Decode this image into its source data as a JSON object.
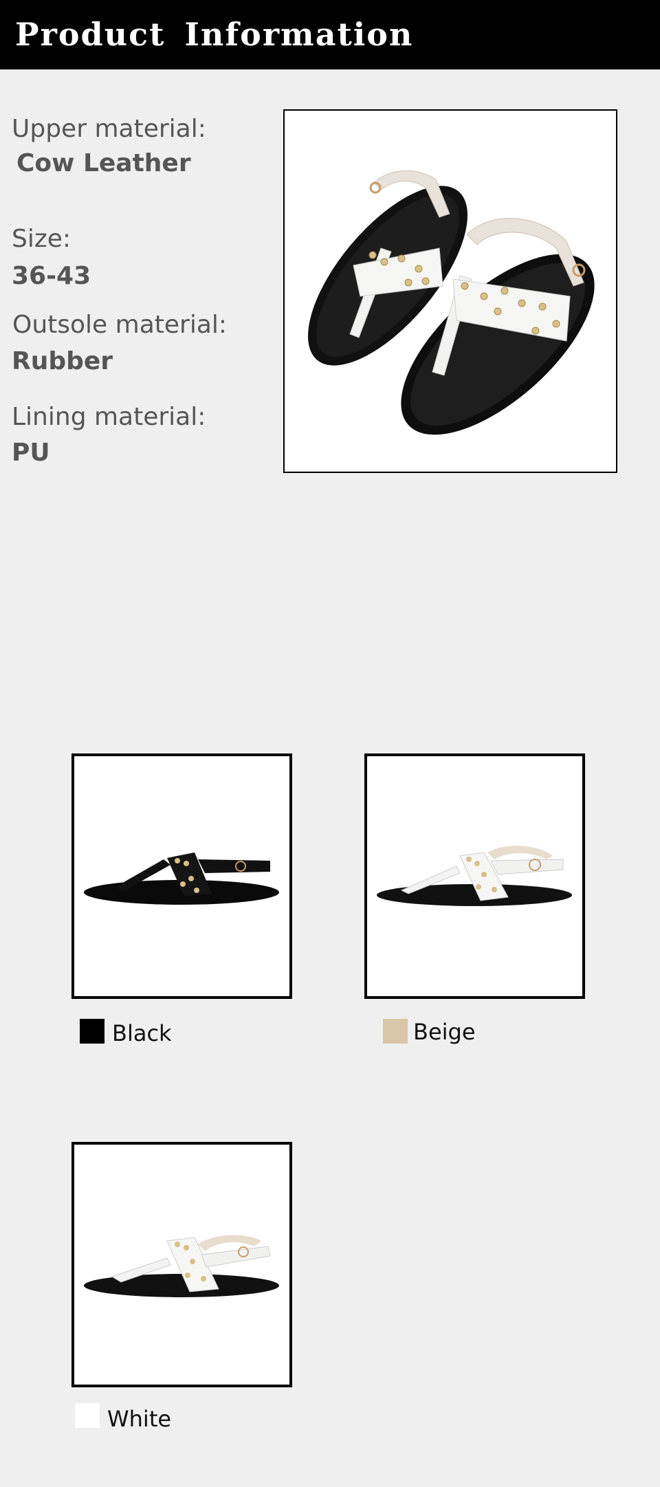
{
  "header": {
    "title": "Product  Information"
  },
  "specs": [
    {
      "label": "Upper material:",
      "value": "Cow Leather"
    },
    {
      "label": "Size:",
      "value": "36-43"
    },
    {
      "label": "Outsole material:",
      "value": "Rubber"
    },
    {
      "label": "Lining material:",
      "value": "PU"
    }
  ],
  "colors": [
    {
      "name": "Black",
      "swatch": "#000000"
    },
    {
      "name": "Beige",
      "swatch": "#d9c6a8"
    },
    {
      "name": "White",
      "swatch": "#ffffff"
    }
  ],
  "images": {
    "hero": "sandal-pair-image",
    "variants": [
      "black-sandal-image",
      "beige-sandal-image",
      "white-sandal-image"
    ]
  }
}
